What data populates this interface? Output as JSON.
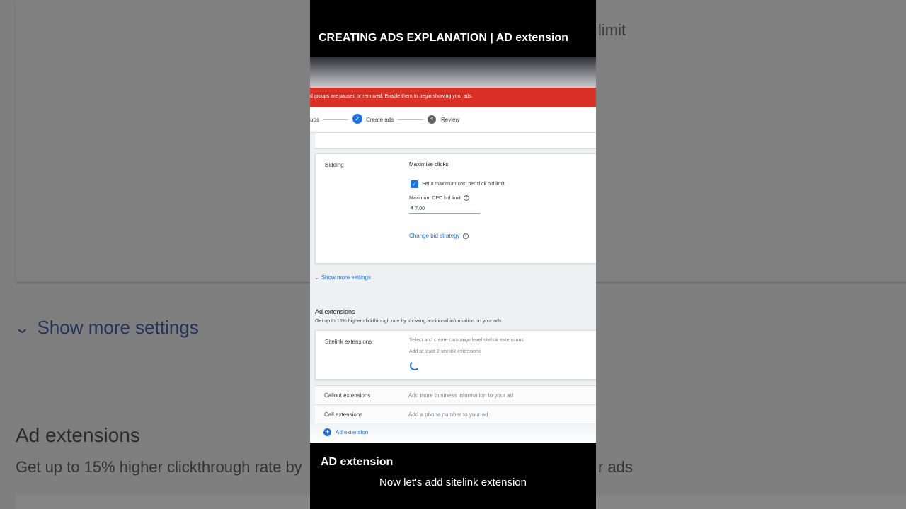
{
  "background": {
    "limit_text": "limit",
    "show_more_settings": "Show more settings",
    "ad_extensions_title": "Ad extensions",
    "ad_extensions_sub": "Get up to 15% higher clickthrough rate by",
    "ads_fragment": "r ads"
  },
  "video": {
    "title": "CREATING ADS EXPLANATION | AD extension",
    "caption_title": "AD extension",
    "caption_sub": "Now let's add sitelink extension"
  },
  "alert": {
    "text": "d groups are paused or removed. Enable them to begin showing your ads."
  },
  "stepper": {
    "prev_step": "ups",
    "current_step": "Create ads",
    "next_step_number": "4",
    "next_step": "Review"
  },
  "bidding": {
    "label": "Bidding",
    "strategy": "Maximise clicks",
    "checkbox_label": "Set a maximum cost per click bid limit",
    "checkbox_checked": true,
    "max_cpc_label": "Maximum CPC bid limit",
    "max_cpc_value": "₹ 7.00",
    "change_link": "Change bid strategy"
  },
  "show_more": "Show more settings",
  "ad_extensions": {
    "title": "Ad extensions",
    "subtitle": "Get up to 15% higher clickthrough rate by showing additional information on your ads",
    "sitelink": {
      "label": "Sitelink extensions",
      "line1": "Select and create campaign level sitelink extensions",
      "line2": "Add at least 2 sitelink extensions"
    },
    "callout": {
      "label": "Callout extensions",
      "desc": "Add more business information to your ad"
    },
    "call": {
      "label": "Call extensions",
      "desc": "Add a phone number to your ad"
    },
    "add_button": "Ad extension"
  },
  "colors": {
    "alert_red": "#d93025",
    "link_blue": "#1a73e8"
  },
  "icons": [
    "check-circle-icon",
    "help-icon",
    "chevron-down-icon",
    "loading-spinner-icon",
    "plus-circle-icon"
  ]
}
